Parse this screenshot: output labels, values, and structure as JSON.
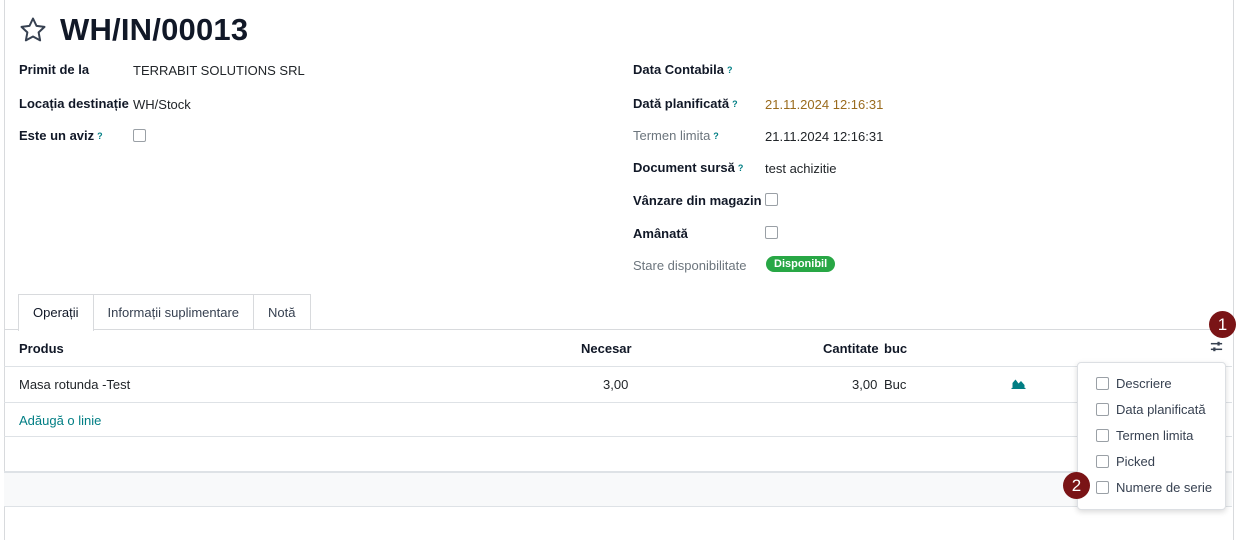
{
  "record": {
    "title": "WH/IN/00013"
  },
  "left_fields": {
    "partner_label": "Primit de la",
    "partner_value": "TERRABIT SOLUTIONS SRL",
    "location_label": "Locația destinație",
    "location_value": "WH/Stock",
    "aviz_label": "Este un aviz",
    "aviz_help": "?"
  },
  "right_fields": {
    "accounting_date_label": "Data Contabila",
    "accounting_date_help": "?",
    "scheduled_label": "Dată planificată",
    "scheduled_help": "?",
    "scheduled_value": "21.11.2024 12:16:31",
    "deadline_label": "Termen limita",
    "deadline_help": "?",
    "deadline_value": "21.11.2024 12:16:31",
    "source_label": "Document sursă",
    "source_help": "?",
    "source_value": "test achizitie",
    "shop_sale_label": "Vânzare din magazin",
    "postponed_label": "Amânată",
    "availability_label": "Stare disponibilitate",
    "availability_value": "Disponibil"
  },
  "tabs": [
    "Operații",
    "Informații suplimentare",
    "Notă"
  ],
  "table": {
    "headers": {
      "product": "Produs",
      "needed": "Necesar",
      "quantity": "Cantitate",
      "uom": "buc"
    },
    "rows": [
      {
        "product": "Masa rotunda -Test",
        "needed": "3,00",
        "quantity": "3,00",
        "uom": "Buc"
      }
    ],
    "add_line": "Adăugă o linie"
  },
  "column_options": [
    "Descriere",
    "Data planificată",
    "Termen limita",
    "Picked",
    "Numere de serie"
  ],
  "markers": [
    "1",
    "2"
  ],
  "colors": {
    "accent": "#017e84",
    "badge": "#28a745",
    "warning_date": "#9a6b1d",
    "marker": "#7a1416"
  }
}
